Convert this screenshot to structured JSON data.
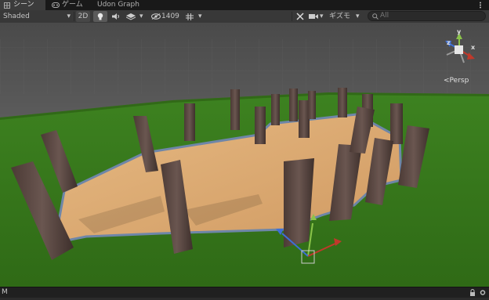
{
  "tabs": [
    {
      "label": "シーン",
      "icon": "grid-icon",
      "active": true
    },
    {
      "label": "ゲーム",
      "icon": "gamepad-icon",
      "active": false
    },
    {
      "label": "Udon Graph",
      "active": false
    }
  ],
  "toolbar": {
    "shading_mode": "Shaded",
    "toggle_2d": "2D",
    "hidden_count": "1409",
    "gizmos_label": "ギズモ",
    "search_placeholder": "All"
  },
  "scene_gizmo": {
    "projection_label": "Persp",
    "axes": [
      "x",
      "y",
      "z"
    ]
  },
  "statusbar": {
    "left_text": "M"
  },
  "colors": {
    "grass": "#3a7a1e",
    "sky": "#525252",
    "plank": "#e0b07a",
    "outline": "#6e86a8",
    "axis_x": "#c0392b",
    "axis_y": "#8bc34a",
    "axis_z": "#3d6fd6"
  }
}
